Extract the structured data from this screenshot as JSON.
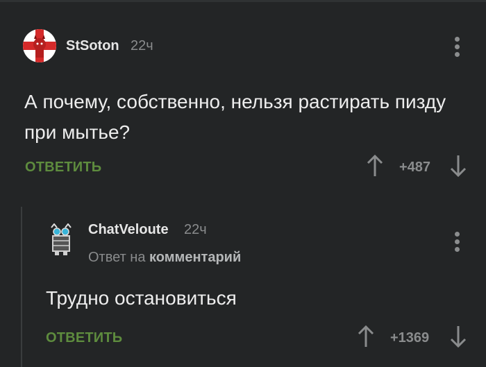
{
  "comments": [
    {
      "author": "StSoton",
      "time": "22ч",
      "text": "А почему, собственно, нельзя растирать пизду при мытье?",
      "reply_label": "ОТВЕТИТЬ",
      "score": "+487",
      "avatar": "devil-flag-avatar-icon"
    },
    {
      "author": "ChatVeloute",
      "time": "22ч",
      "reply_to_prefix": "Ответ на",
      "reply_to_link": "комментарий",
      "text": "Трудно остановиться",
      "reply_label": "ОТВЕТИТЬ",
      "score": "+1369",
      "avatar": "robot-cat-avatar-icon"
    }
  ],
  "colors": {
    "background": "#232526",
    "reply_green": "#5e8c3e",
    "muted": "#8a8c8d"
  }
}
